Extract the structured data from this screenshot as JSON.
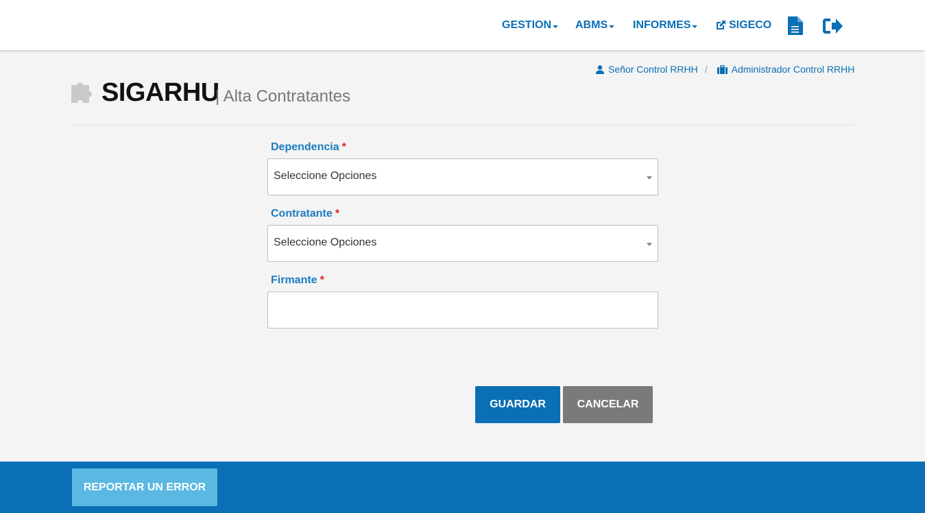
{
  "nav": {
    "gestion": "GESTION",
    "abms": "ABMS",
    "informes": "INFORMES",
    "sigeco": "SIGECO",
    "icons": [
      "external-link-icon",
      "document-icon",
      "sign-out-icon"
    ]
  },
  "breadcrumb": {
    "user": "Señor Control RRHH",
    "separator": "/",
    "role": "Administrador Control RRHH"
  },
  "header": {
    "app_title": "SIGARHU",
    "page_subtitle": "| Alta Contratantes"
  },
  "form": {
    "dependencia": {
      "label": "Dependencia",
      "required": "*",
      "value": "Seleccione Opciones"
    },
    "contratante": {
      "label": "Contratante",
      "required": "*",
      "value": "Seleccione Opciones"
    },
    "firmante": {
      "label": "Firmante",
      "required": "*",
      "value": ""
    }
  },
  "actions": {
    "save": "GUARDAR",
    "cancel": "CANCELAR"
  },
  "footer": {
    "report_error": "REPORTAR UN ERROR"
  },
  "colors": {
    "primary": "#0a6fb5",
    "label": "#1a7cc1",
    "required": "#e0202a",
    "cancel": "#7a7a7a",
    "report": "#5ab8e3",
    "background": "#f4f4f4"
  }
}
